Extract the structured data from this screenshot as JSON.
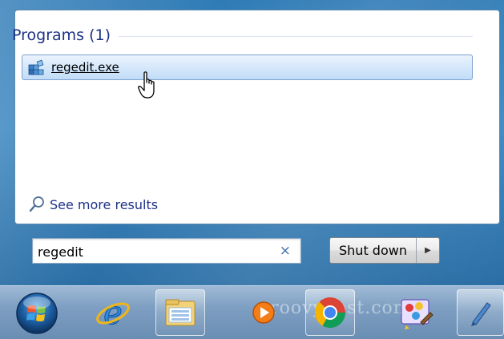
{
  "results": {
    "section_title": "Programs (1)",
    "items": [
      {
        "label": "regedit.exe",
        "icon": "registry-editor-icon"
      }
    ],
    "see_more": "See more results"
  },
  "search": {
    "value": "regedit",
    "clear_icon": "×"
  },
  "power": {
    "shutdown_label": "Shut down",
    "options_glyph": "▶"
  },
  "taskbar": {
    "items": [
      {
        "name": "start-button",
        "icon": "windows-orb-icon"
      },
      {
        "name": "internet-explorer",
        "icon": "internet-explorer-icon"
      },
      {
        "name": "windows-explorer",
        "icon": "folder-icon"
      },
      {
        "name": "media-player",
        "icon": "media-player-icon"
      },
      {
        "name": "google-chrome",
        "icon": "chrome-icon"
      },
      {
        "name": "paint-app",
        "icon": "paint-icon"
      },
      {
        "name": "pen-app",
        "icon": "pen-icon"
      }
    ],
    "watermark": "groovyPost.com"
  },
  "colors": {
    "accent": "#1e3287",
    "selection": "#c2dcf7",
    "frame": "#3f89c2"
  }
}
